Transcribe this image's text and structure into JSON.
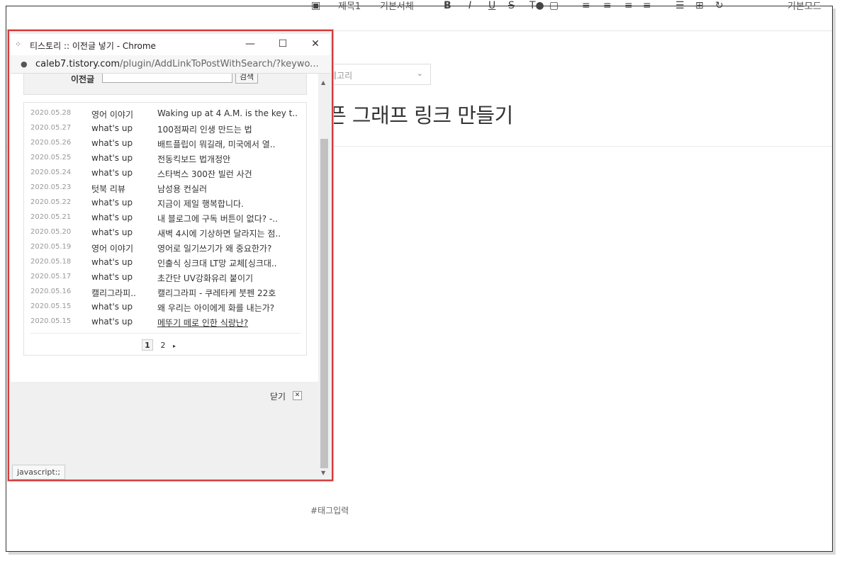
{
  "editor": {
    "toolbar_items": [
      "제목1",
      "기본서체"
    ],
    "toolbar_right": "기본모드",
    "category_placeholder": "카테고리",
    "post_title": "픈 그래프 링크 만들기",
    "tag_placeholder": "#태그입력"
  },
  "popup": {
    "window_title": "티스토리 :: 이전글 넣기 - Chrome",
    "url_host": "caleb7.tistory.com",
    "url_path": "/plugin/AddLinkToPostWithSearch/?keywo...",
    "search_label": "이전글",
    "search_button": "검색",
    "rows": [
      {
        "date": "2020.05.28",
        "category": "영어 이야기",
        "title": "Waking up at 4 A.M. is the key t.."
      },
      {
        "date": "2020.05.27",
        "category": "what's up",
        "title": "100점짜리 인생 만드는 법"
      },
      {
        "date": "2020.05.26",
        "category": "what's up",
        "title": "배트플립이 뭐길래, 미국에서 열.."
      },
      {
        "date": "2020.05.25",
        "category": "what's up",
        "title": "전동킥보드 법개정안"
      },
      {
        "date": "2020.05.24",
        "category": "what's up",
        "title": "스타벅스 300잔 빌런 사건"
      },
      {
        "date": "2020.05.23",
        "category": "텃북 리뷰",
        "title": "남성용 컨실러"
      },
      {
        "date": "2020.05.22",
        "category": "what's up",
        "title": "지금이 제일 행복합니다."
      },
      {
        "date": "2020.05.21",
        "category": "what's up",
        "title": "내 블로그에 구독 버튼이 없다? -.."
      },
      {
        "date": "2020.05.20",
        "category": "what's up",
        "title": "새벽 4시에 기상하면 달라지는 점.."
      },
      {
        "date": "2020.05.19",
        "category": "영어 이야기",
        "title": "영어로 일기쓰기가 왜 중요한가?"
      },
      {
        "date": "2020.05.18",
        "category": "what's up",
        "title": "인출식 싱크대 LT망 교체[싱크대.."
      },
      {
        "date": "2020.05.17",
        "category": "what's up",
        "title": "초간단 UV강화유리 붙이기"
      },
      {
        "date": "2020.05.16",
        "category": "캘리그라피..",
        "title": "캘리그라피 - 쿠레타케 붓펜 22호"
      },
      {
        "date": "2020.05.15",
        "category": "what's up",
        "title": "왜 우리는 아이에게 화를 내는가?"
      },
      {
        "date": "2020.05.15",
        "category": "what's up",
        "title": "메뚜기 떼로 인한 식량난?"
      }
    ],
    "pages": [
      "1",
      "2"
    ],
    "next_glyph": "▸",
    "close_label": "닫기",
    "close_x": "✕",
    "status_text": "javascript:;",
    "min_glyph": "—",
    "max_glyph": "☐",
    "close_glyph": "✕",
    "logo_glyph": "⁘",
    "lock_glyph": "🔒"
  }
}
